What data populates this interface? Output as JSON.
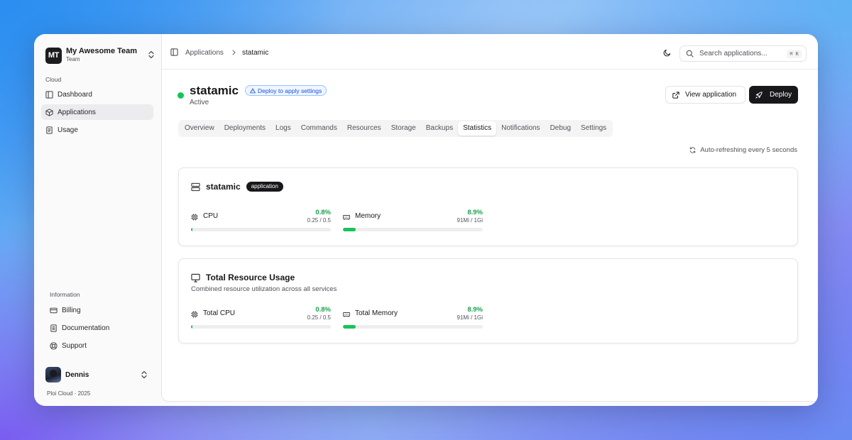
{
  "team": {
    "initials": "MT",
    "name": "My Awesome Team",
    "role": "Team"
  },
  "sidebar": {
    "section_cloud": "Cloud",
    "items": [
      {
        "label": "Dashboard",
        "icon": "layout-icon"
      },
      {
        "label": "Applications",
        "icon": "package-icon",
        "active": true
      },
      {
        "label": "Usage",
        "icon": "document-icon"
      }
    ],
    "section_info": "Information",
    "info_items": [
      {
        "label": "Billing",
        "icon": "credit-card-icon"
      },
      {
        "label": "Documentation",
        "icon": "book-icon"
      },
      {
        "label": "Support",
        "icon": "lifebuoy-icon"
      }
    ]
  },
  "user": {
    "name": "Dennis"
  },
  "footer": "Ploi Cloud · 2025",
  "breadcrumb": {
    "parent": "Applications",
    "current": "statamic"
  },
  "search": {
    "placeholder": "Search applications...",
    "shortcut": "⌘ K"
  },
  "app": {
    "name": "statamic",
    "status": "Active",
    "hint": "Deploy to apply settings",
    "status_color": "#16c45a"
  },
  "actions": {
    "view": "View application",
    "deploy": "Deploy"
  },
  "tabs": [
    {
      "label": "Overview"
    },
    {
      "label": "Deployments"
    },
    {
      "label": "Logs"
    },
    {
      "label": "Commands"
    },
    {
      "label": "Resources"
    },
    {
      "label": "Storage"
    },
    {
      "label": "Backups"
    },
    {
      "label": "Statistics",
      "active": true
    },
    {
      "label": "Notifications"
    },
    {
      "label": "Debug"
    },
    {
      "label": "Settings"
    }
  ],
  "autorefresh": "Auto-refreshing every 5 seconds",
  "service_card": {
    "name": "statamic",
    "badge": "application",
    "cpu": {
      "label": "CPU",
      "percent": "0.8%",
      "detail": "0.25 / 0.5",
      "fill_fraction": 0.008
    },
    "memory": {
      "label": "Memory",
      "percent": "8.9%",
      "detail": "91Mi / 1Gi",
      "fill_fraction": 0.089
    }
  },
  "total_card": {
    "title": "Total Resource Usage",
    "subtitle": "Combined resource utilization across all services",
    "cpu": {
      "label": "Total CPU",
      "percent": "0.8%",
      "detail": "0.25 / 0.5",
      "fill_fraction": 0.008
    },
    "memory": {
      "label": "Total Memory",
      "percent": "8.9%",
      "detail": "91Mi / 1Gi",
      "fill_fraction": 0.089
    }
  },
  "colors": {
    "accent_green": "#16a34a",
    "bar_green": "#16c45a",
    "hint_blue": "#1d4ed8",
    "dark": "#18181b"
  }
}
